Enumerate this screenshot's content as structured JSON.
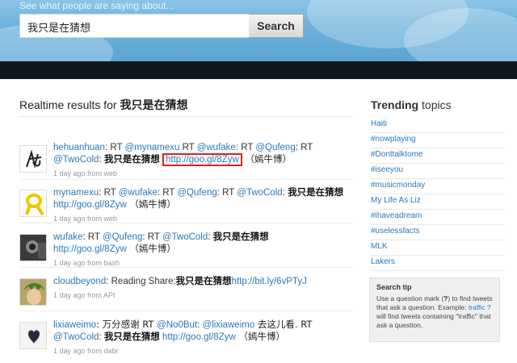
{
  "header": {
    "tagline": "See what people are saying about...",
    "search_value": "我只是在猜想",
    "search_button": "Search"
  },
  "results": {
    "title_prefix": "Realtime results for ",
    "title_query": "我只是在猜想"
  },
  "tweets": [
    {
      "user": "hehuanhuan",
      "text_a": ": RT ",
      "m1": "@mynamexu",
      "text_b": " RT ",
      "m2": "@wufake",
      "text_c": ": RT ",
      "m3": "@Qufeng",
      "text_d": ": RT",
      "m4": "@TwoCold",
      "text_e": ": ",
      "cjk": "我只是在猜想",
      "link": "http://goo.gl/8Zyw",
      "tail": " （嫣牛博）",
      "meta": "1 day ago from web"
    },
    {
      "user": "mynamexu",
      "text_a": ": RT ",
      "m1": "@wufake",
      "text_b": ": RT ",
      "m2": "@Qufeng",
      "text_c": ": RT ",
      "m3": "@TwoCold",
      "text_d": ": ",
      "cjk": "我只是在猜想",
      "link": "http://goo.gl/8Zyw",
      "tail": " （嫣牛博）",
      "meta": "1 day ago from web"
    },
    {
      "user": "wufake",
      "text_a": ": RT ",
      "m1": "@Qufeng",
      "text_b": ": RT ",
      "m2": "@TwoCold",
      "text_c": ": ",
      "cjk": "我只是在猜想",
      "link": "http://goo.gl/8Zyw",
      "tail": " （嫣牛博）",
      "meta": "1 day ago from bash"
    },
    {
      "user": "cloudbeyond",
      "text_a": ": Reading Share:",
      "cjk": "我只是在猜想",
      "link": "http://bit.ly/6vPTyJ",
      "meta": "1 day ago from API"
    },
    {
      "user": "lixiaweimo",
      "text_a": ": 万分感谢  RT ",
      "m1": "@No0But",
      "text_b": ": ",
      "m2": "@lixiaweimo",
      "text_c": " 去这儿看. RT",
      "m3": "@TwoCold",
      "text_d": ": ",
      "cjk": "我只是在猜想",
      "link": "http://goo.gl/8Zyw",
      "tail": " （嫣牛博）",
      "meta": "1 day ago from dabr"
    }
  ],
  "sidebar": {
    "trending_bold": "Trending",
    "trending_rest": " topics",
    "topics": [
      "Haiti",
      "#nowplaying",
      "#Donttalktome",
      "#iseeyou",
      "#musicmonday",
      "My Life As Liz",
      "#ihaveadream",
      "#uselessfacts",
      "MLK",
      "Lakers"
    ],
    "tip_title": "Search tip",
    "tip_text_a": "Use a question mark (",
    "tip_q": "?",
    "tip_text_b": ") to find tweets that ask a question. Example: ",
    "tip_link": "traffic ?",
    "tip_text_c": " will find tweets containing \"traffic\" that ask a question."
  }
}
